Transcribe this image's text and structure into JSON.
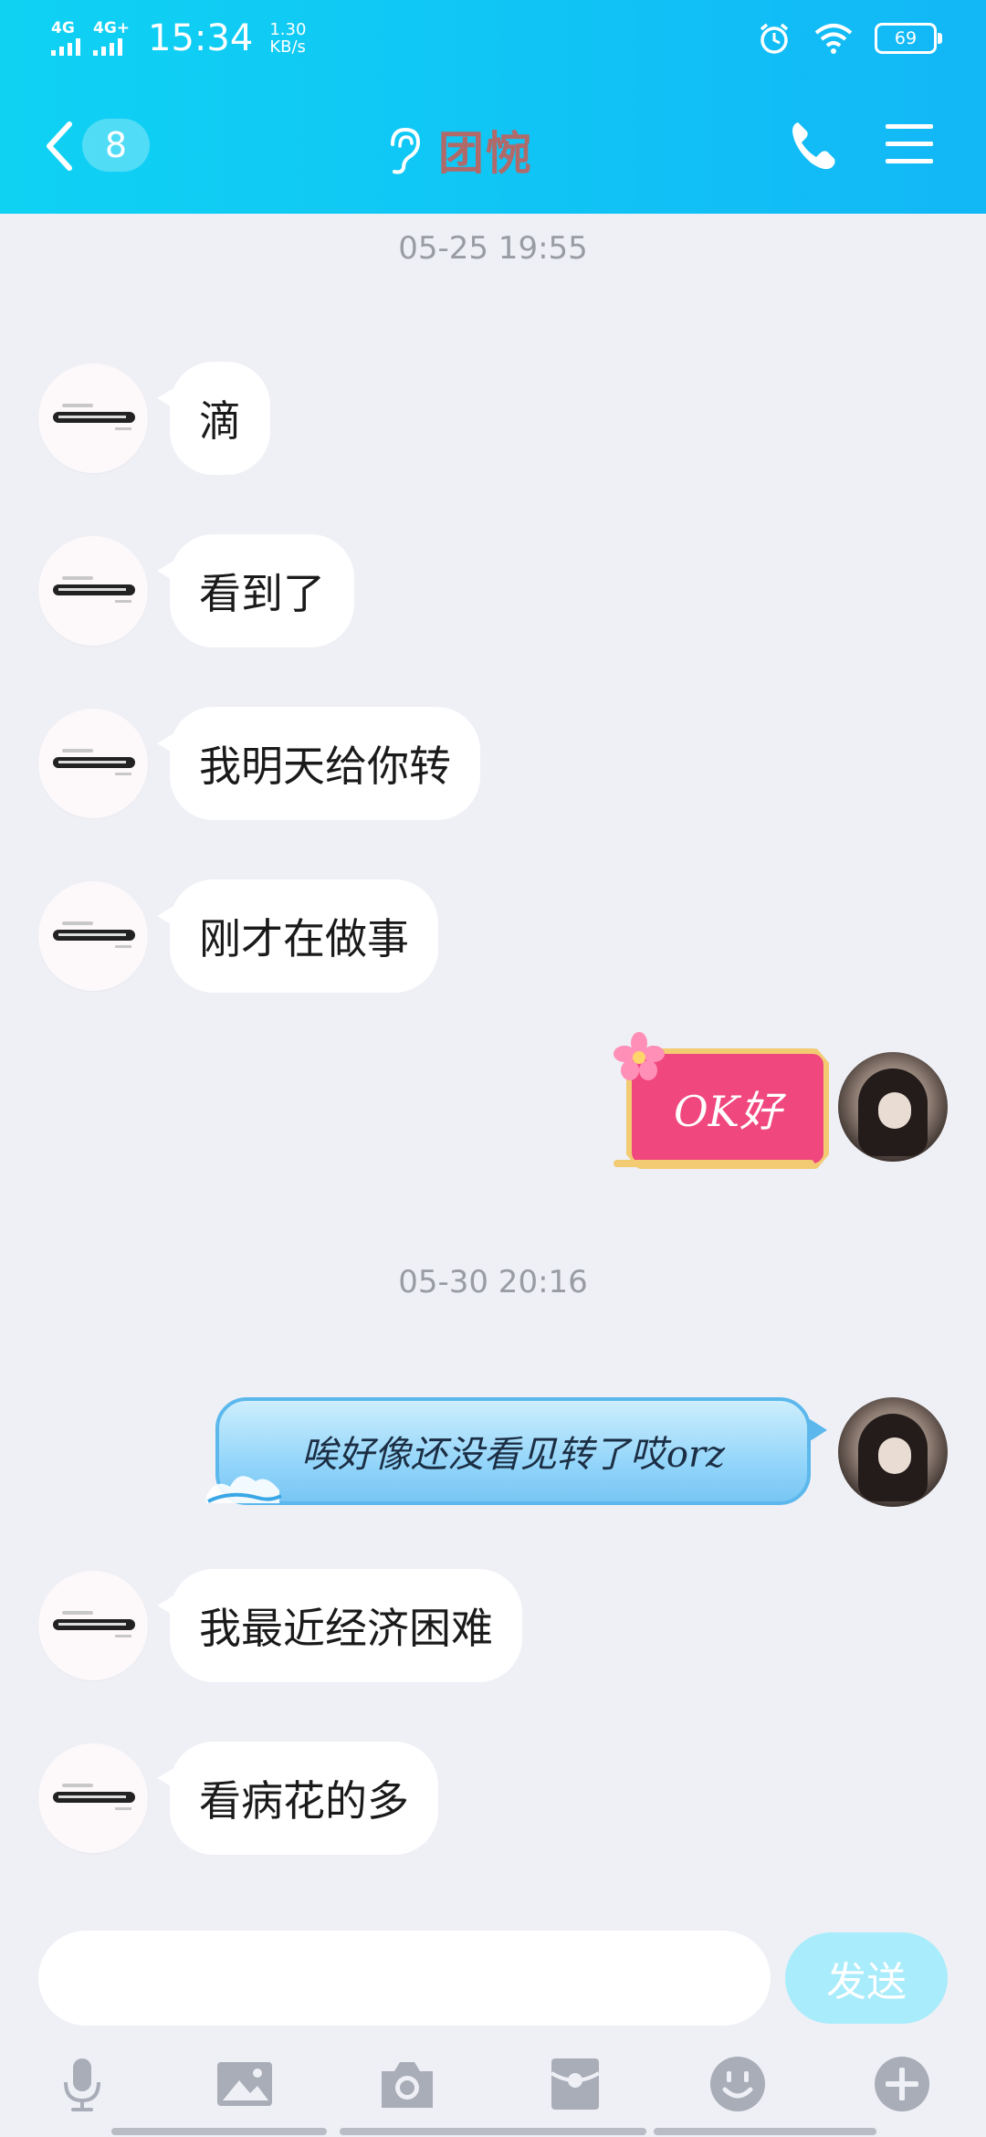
{
  "status_bar": {
    "net1": "4G",
    "net2": "4G+",
    "time": "15:34",
    "speed_value": "1.30",
    "speed_unit": "KB/s",
    "battery": "69"
  },
  "header": {
    "unread_count": "8",
    "title": "团惋"
  },
  "messages": {
    "ts1": "05-25 19:55",
    "m1": "滴",
    "m2": "看到了",
    "m3": "我明天给你转",
    "m4": "刚才在做事",
    "sticker_text": "OK好",
    "ts2": "05-30 20:16",
    "m5": "唉好像还没看见转了哎orz",
    "m6": "我最近经济困难",
    "m7": "看病花的多"
  },
  "input": {
    "placeholder": "",
    "send_label": "发送"
  },
  "colors": {
    "header_gradient_start": "#0fd2f3",
    "header_gradient_end": "#12b7f6",
    "chat_background": "#eef0f6",
    "send_button": "#a9ecfb",
    "sticker_pink": "#f0477f"
  },
  "icons": {
    "header": [
      "back-chevron-icon",
      "ear-icon",
      "phone-icon",
      "menu-icon"
    ],
    "toolbar": [
      "microphone-icon",
      "image-icon",
      "camera-icon",
      "red-packet-icon",
      "emoji-icon",
      "plus-icon"
    ]
  }
}
